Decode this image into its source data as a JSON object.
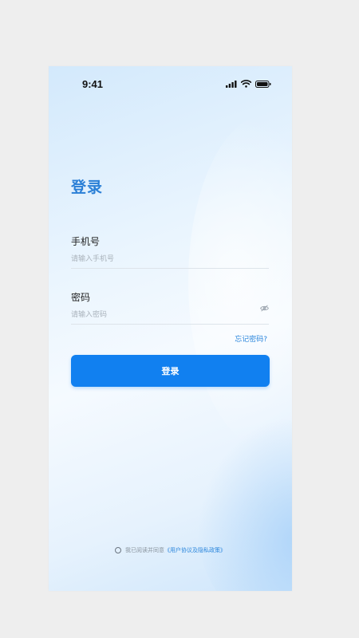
{
  "status_bar": {
    "time": "9:41"
  },
  "login": {
    "title": "登录",
    "phone": {
      "label": "手机号",
      "placeholder": "请输入手机号",
      "value": ""
    },
    "password": {
      "label": "密码",
      "placeholder": "请输入密码",
      "value": ""
    },
    "forgot_label": "忘记密码?",
    "submit_label": "登录"
  },
  "agreement": {
    "prefix": "我已阅读并同意",
    "link_text": "《用户协议及隐私政策》"
  },
  "icons": {
    "signal": "signal-icon",
    "wifi": "wifi-icon",
    "battery": "battery-icon",
    "eye": "eye-off-icon"
  },
  "colors": {
    "accent": "#1180f0",
    "title": "#2a7fd6",
    "link": "#2b86dc"
  }
}
